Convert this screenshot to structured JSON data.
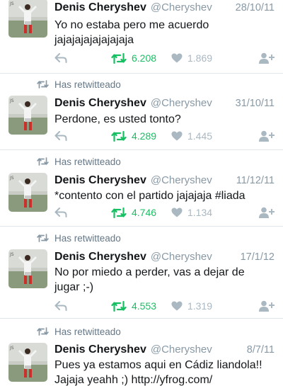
{
  "retweet_context": "Has retwitteado",
  "colors": {
    "retweet_green": "#17bf63",
    "icon_gray": "#aab8c2",
    "text_secondary": "#8899a6",
    "divider": "#e1e8ed"
  },
  "icons": {
    "reply": "reply-icon",
    "retweet": "retweet-icon",
    "like": "heart-icon",
    "follow": "add-user-icon"
  },
  "tweets": [
    {
      "name": "Denis Cheryshev",
      "handle": "@Cheryshev",
      "date": "28/10/11",
      "lines": [
        "Yo no estaba pero me acuerdo",
        "jajajajajajajajaja"
      ],
      "retweets": "6.208",
      "likes": "1.869",
      "retweeted_by_you": false
    },
    {
      "name": "Denis Cheryshev",
      "handle": "@Cheryshev",
      "date": "31/10/11",
      "lines": [
        "Perdone, es usted tonto?"
      ],
      "retweets": "4.289",
      "likes": "1.445",
      "retweeted_by_you": true
    },
    {
      "name": "Denis Cheryshev",
      "handle": "@Cheryshev",
      "date": "11/12/11",
      "lines": [
        "*contento con el partido jajajaja #liada"
      ],
      "retweets": "4.746",
      "likes": "1.134",
      "retweeted_by_you": true
    },
    {
      "name": "Denis Cheryshev",
      "handle": "@Cheryshev",
      "date": "17/1/12",
      "lines": [
        "No por miedo a perder, vas a dejar de",
        "jugar ;-)"
      ],
      "retweets": "4.553",
      "likes": "1.319",
      "retweeted_by_you": true
    },
    {
      "name": "Denis Cheryshev",
      "handle": "@Cheryshev",
      "date": "8/7/11",
      "lines": [
        "Pues ya estamos aqui en Cádiz liandola!!",
        "Jajaja yeahh ;) http://yfrog.com/"
      ],
      "retweets": "",
      "likes": "",
      "retweeted_by_you": true
    }
  ]
}
